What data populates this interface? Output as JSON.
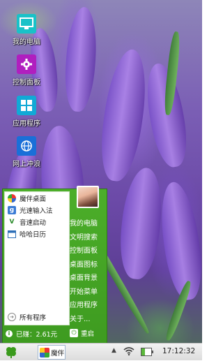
{
  "desktop": {
    "icons": [
      {
        "label": "我的电脑",
        "icon": "monitor-icon",
        "color": "#19c2c8"
      },
      {
        "label": "控制面板",
        "icon": "gear-icon",
        "color": "#b01fbf"
      },
      {
        "label": "应用程序",
        "icon": "grid-icon",
        "color": "#12a9d6"
      },
      {
        "label": "网上冲浪",
        "icon": "globe-icon",
        "color": "#1a6fd8"
      }
    ]
  },
  "start_menu": {
    "left_items": [
      {
        "label": "魔伴桌面",
        "icon": "pinwheel-icon"
      },
      {
        "label": "光速输入法",
        "icon": "input-method-icon"
      },
      {
        "label": "音速启动",
        "icon": "launcher-icon"
      },
      {
        "label": "哈哈日历",
        "icon": "calendar-icon"
      }
    ],
    "all_programs": "所有程序",
    "right_items": [
      "我的电脑",
      "文明搜索",
      "控制面板",
      "桌面图标",
      "桌面背景",
      "开始菜单",
      "应用程序",
      "关于..."
    ],
    "earned": "已赚：2.61元",
    "restart": "重启",
    "accent_color": "#3e9b20"
  },
  "taskbar": {
    "app_label": "魔伴",
    "clock": "17:12:32",
    "battery_level": 0.35
  }
}
